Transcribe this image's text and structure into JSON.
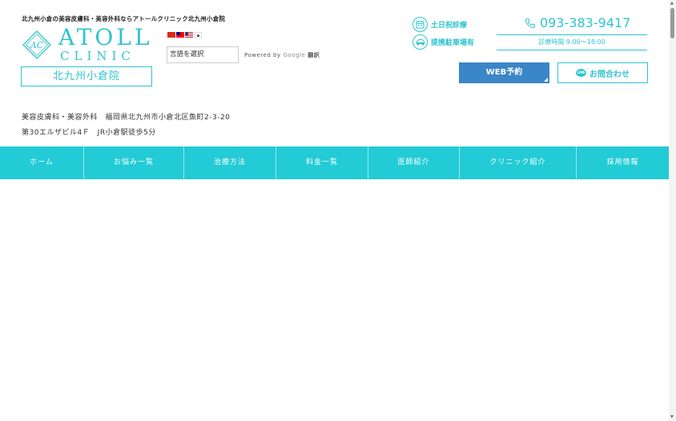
{
  "header": {
    "tagline": "北九州小倉の美容皮膚科・美容外科ならアトールクリニック北九州小倉院",
    "logo_word": "ATOLL",
    "logo_sub": "CLINIC",
    "logo_mark": "AC",
    "branch": "北九州小倉院"
  },
  "translate": {
    "flags": [
      "flag-cn-icon",
      "flag-tw-icon",
      "flag-us-icon",
      "flag-kr-icon"
    ],
    "select_label": "言語を選択",
    "powered_by": "Powered by",
    "google": "Google",
    "translate_label": "翻訳"
  },
  "info": {
    "weekend": "土日祝診療",
    "parking": "提携駐車場有",
    "phone": "093-383-9417",
    "hours": "診療時間 9:00〜18:00"
  },
  "buttons": {
    "web_reserve": "WEB予約",
    "line_icon_text": "LINE",
    "contact": "お問合わせ"
  },
  "address": {
    "line1": "美容皮膚科・美容外科　福岡県北九州市小倉北区魚町2-3-20",
    "line2": "第30エルザビル4Ｆ　JR小倉駅徒歩5分"
  },
  "nav": [
    {
      "label": "ホーム"
    },
    {
      "label": "お悩み一覧"
    },
    {
      "label": "治療方法"
    },
    {
      "label": "料金一覧"
    },
    {
      "label": "医師紹介"
    },
    {
      "label": "クリニック紹介"
    },
    {
      "label": "採用情報"
    }
  ],
  "colors": {
    "accent": "#2fc4cf",
    "nav_bg": "#22cbd5",
    "web_button": "#3b86c6"
  }
}
